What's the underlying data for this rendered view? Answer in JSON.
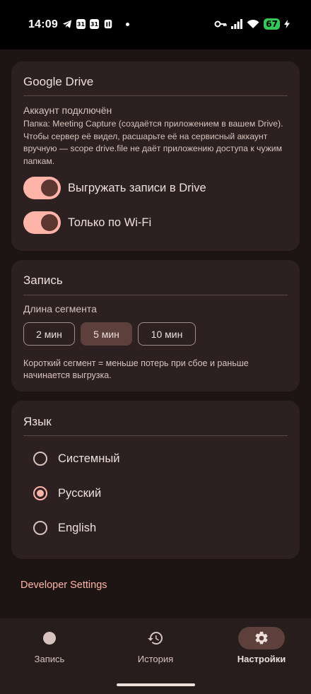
{
  "status_bar": {
    "time": "14:09",
    "calendar_badge_1": "31",
    "calendar_badge_2": "31",
    "battery": "67",
    "icons": [
      "telegram-icon",
      "calendar-icon",
      "calendar-icon",
      "sim-icon",
      "dot-icon",
      "key-icon",
      "signal-icon",
      "wifi-icon",
      "battery-icon",
      "charging-icon"
    ]
  },
  "drive_card": {
    "title": "Google Drive",
    "account_status": "Аккаунт подключён",
    "folder_note": "Папка: Meeting Capture (создаётся приложением в вашем Drive). Чтобы сервер её видел, расшарьте её на сервисный аккаунт вручную — scope drive.file не даёт приложению доступа к чужим папкам.",
    "upload_toggle_label": "Выгружать записи в Drive",
    "upload_toggle_on": true,
    "wifi_toggle_label": "Только по Wi-Fi",
    "wifi_toggle_on": true
  },
  "recording_card": {
    "title": "Запись",
    "segment_label": "Длина сегмента",
    "chips": [
      "2 мин",
      "5 мин",
      "10 мин"
    ],
    "selected_chip": "5 мин",
    "hint": "Короткий сегмент = меньше потерь при сбое и раньше начинается выгрузка."
  },
  "language_card": {
    "title": "Язык",
    "options": [
      "Системный",
      "Русский",
      "English"
    ],
    "selected": "Русский"
  },
  "developer_link": "Developer Settings",
  "bottom_nav": {
    "items": [
      {
        "label": "Запись",
        "icon": "record-dot-icon"
      },
      {
        "label": "История",
        "icon": "history-icon"
      },
      {
        "label": "Настройки",
        "icon": "gear-icon"
      }
    ],
    "active": "Настройки"
  },
  "colors": {
    "background": "#1d1514",
    "card": "#2c2120",
    "accent": "#ffb4a9",
    "selected_container": "#5d3f3b",
    "text_primary": "#ecdfdc",
    "text_secondary": "#d8c2bd"
  }
}
